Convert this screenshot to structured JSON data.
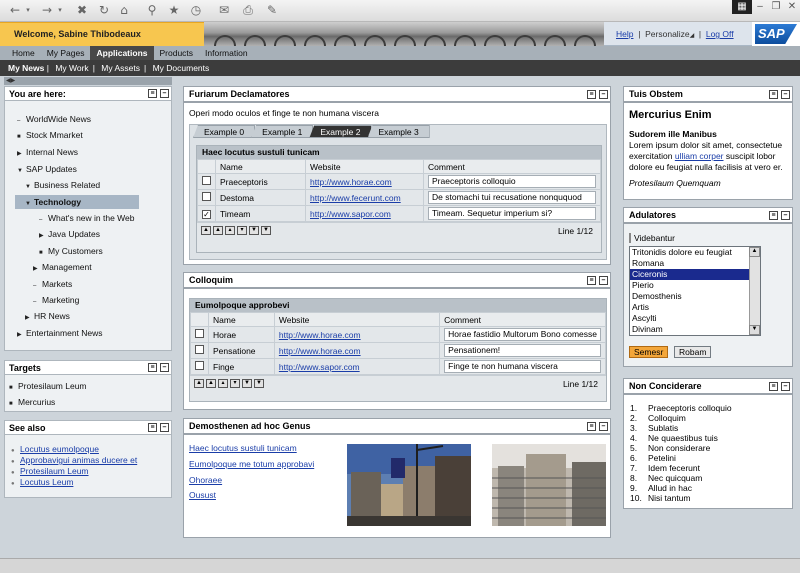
{
  "header": {
    "welcome": "Welcome, Sabine Thibodeaux",
    "help": "Help",
    "personalize": "Personalize",
    "logoff": "Log Off",
    "logo": "SAP",
    "top_tabs": [
      "Home",
      "My Pages",
      "Applications",
      "Products",
      "Information"
    ],
    "active_top_tab": "Applications",
    "sub_tabs": [
      "My News",
      "My Work",
      "My Assets",
      "My Documents"
    ],
    "active_sub_tab": "My News"
  },
  "nav": {
    "title": "You are here:",
    "items": [
      {
        "label": "WorldWide News",
        "bullet": "dash"
      },
      {
        "label": "Stock Mmarket",
        "bullet": "green"
      },
      {
        "label": "Internal News",
        "bullet": "arrow-right"
      },
      {
        "label": "SAP Updates",
        "bullet": "arrow-down"
      },
      {
        "label": "Business Related",
        "bullet": "arrow-down"
      },
      {
        "label": "Technology",
        "bullet": "arrow-down"
      },
      {
        "label": "What's new in the Web",
        "bullet": "dash"
      },
      {
        "label": "Java Updates",
        "bullet": "arrow-right"
      },
      {
        "label": "My Customers",
        "bullet": "green"
      },
      {
        "label": "Management",
        "bullet": "arrow-right"
      },
      {
        "label": "Markets",
        "bullet": "dash"
      },
      {
        "label": "Marketing",
        "bullet": "dash"
      },
      {
        "label": "HR News",
        "bullet": "arrow-right"
      },
      {
        "label": "Entertainment News",
        "bullet": "arrow-right"
      }
    ]
  },
  "targets": {
    "title": "Targets",
    "items": [
      "Protesilaum Leum",
      "Mercurius"
    ]
  },
  "see_also": {
    "title": "See also",
    "items": [
      "Locutus eumolpoque",
      "Approbavigui animas ducere et",
      "Protesilaum Leum",
      "Locutus  Leum"
    ]
  },
  "panel1": {
    "title": "Furiarum Declamatores",
    "text": "Operi modo oculos et finge te non humana viscera",
    "tabs": [
      "Example 0",
      "Example 1",
      "Example 2",
      "Example 3"
    ],
    "active_tab": "Example 2",
    "table_title": "Haec locutus sustuli tunicam",
    "columns": [
      "Name",
      "Website",
      "Comment"
    ],
    "rows": [
      {
        "checked": false,
        "name": "Praeceptoris",
        "website": "http://www.horae.com",
        "comment": "Praeceptoris colloquio"
      },
      {
        "checked": false,
        "name": "Destoma",
        "website": "http://www.fecerunt.com",
        "comment": "De stomachi tui recusatione nonququod"
      },
      {
        "checked": true,
        "name": "Timeam",
        "website": "http://www.sapor.com",
        "comment": "Timeam. Sequetur imperium si?"
      }
    ],
    "line_info": "Line 1/12"
  },
  "panel2": {
    "title": "Colloquim",
    "table_title": "Eumolpoque approbevi",
    "columns": [
      "Name",
      "Website",
      "Comment"
    ],
    "rows": [
      {
        "checked": false,
        "name": "Horae",
        "website": "http://www.horae.com",
        "comment": "Horae fastidio Multorum Bono comesse"
      },
      {
        "checked": false,
        "name": "Pensatione",
        "website": "http://www.horae.com",
        "comment": "Pensationem!"
      },
      {
        "checked": false,
        "name": "Finge",
        "website": "http://www.sapor.com",
        "comment": "Finge te non humana viscera"
      }
    ],
    "line_info": "Line 1/12"
  },
  "panel3": {
    "title": "Demosthenen ad hoc Genus",
    "links": [
      "Haec locutus sustuli tunicam",
      "Eumolpoque me totum approbavi",
      "Ohoraee",
      "Ousust"
    ]
  },
  "right1": {
    "title": "Tuis Obstem",
    "heading": "Mercurius Enim",
    "subheading": "Sudorem ille Manibus",
    "body_before": "Lorem ipsum dolor sit amet, consectetue exercitation",
    "link": "ulliam corper",
    "body_after": "suscipit lobor dolore eu feugiat nulla facilisis at vero er.",
    "footer": "Protesilaum Quemquam"
  },
  "right2": {
    "title": "Adulatores",
    "label": "Videbantur",
    "list": [
      "Tritonidis dolore eu feugiat",
      "Romana",
      "Ciceronis",
      "Pierio",
      "Demosthenis",
      "Artis",
      "Ascylti",
      "Divinam"
    ],
    "selected": "Ciceronis",
    "btn_primary": "Semesr",
    "btn_secondary": "Robam"
  },
  "right3": {
    "title": "Non Conciderare",
    "items": [
      "Praeceptoris colloquio",
      "Colloquim",
      "Sublatis",
      "Ne quaestibus tuis",
      "Non considerare",
      "Petelini",
      "Idem fecerunt",
      "Nec quicquam",
      "Allud in hac",
      "Nisi tantum"
    ]
  },
  "colors": {
    "accent": "#f7c64f",
    "link": "#1a3da8",
    "green_bullet": "#2b9a2b",
    "selection": "#1a2a8e"
  }
}
